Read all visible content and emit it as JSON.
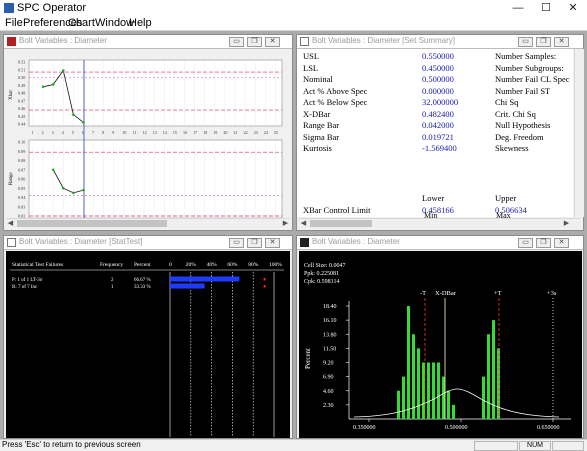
{
  "app": {
    "title": "SPC Operator"
  },
  "window_controls": {
    "minimize": "—",
    "maximize": "☐",
    "close": "✕"
  },
  "menu": [
    "File",
    "Preferences",
    "Chart",
    "Window",
    "Help"
  ],
  "pane_buttons": {
    "minimize": "▭",
    "restore": "❐",
    "close": "✕"
  },
  "panes": {
    "chart": {
      "title": "Bolt Variables : Diameter",
      "xbar_ylabel": "Xbar",
      "range_ylabel": "Range",
      "xbar_ticks": [
        "0.52",
        "0.51",
        "0.50",
        "0.49",
        "0.48",
        "0.47",
        "0.46",
        "0.45",
        "0.44"
      ],
      "range_ticks": [
        "0.10",
        "0.09",
        "0.08",
        "0.07",
        "0.06",
        "0.05",
        "0.04",
        "0.03",
        "0.02"
      ],
      "x_ticks": [
        "1",
        "2",
        "3",
        "4",
        "5",
        "6",
        "7",
        "8",
        "9",
        "10",
        "11",
        "12",
        "13",
        "14",
        "15",
        "16",
        "17",
        "18",
        "19",
        "20",
        "21",
        "22",
        "23",
        "24",
        "25"
      ],
      "xbar_values": [
        0.488,
        0.491,
        0.509,
        0.452,
        0.442
      ],
      "range_values": [
        0.07,
        0.05,
        0.045,
        0.048
      ],
      "xbar_limits": {
        "ucl": 0.507,
        "lcl": 0.458,
        "center": 0.5
      },
      "range_limits": {
        "ucl": 0.089,
        "lcl": 0.0,
        "center": 0.042
      }
    },
    "summary": {
      "title": "Bolt Variables : Diameter  [Set Summary]",
      "rows": [
        {
          "label": "USL",
          "value": "0.550000",
          "label2": "Number Samples:"
        },
        {
          "label": "LSL",
          "value": "0.450000",
          "label2": "Number Subgroups:"
        },
        {
          "label": "Nominal",
          "value": "0.500000",
          "label2": "Number Fail CL Spec"
        },
        {
          "label": "Act % Above Spec",
          "value": "0.000000",
          "label2": "Number Fail ST"
        },
        {
          "label": "Act % Below Spec",
          "value": "32.000000",
          "label2": "Chi Sq"
        },
        {
          "label": "X-DBar",
          "value": "0.482400",
          "label2": "Crit. Chi Sq"
        },
        {
          "label": "Range Bar",
          "value": "0.042000",
          "label2": "Null Hypothesis"
        },
        {
          "label": "Sigma Bar",
          "value": "0.019721",
          "label2": "Deg. Freedom"
        },
        {
          "label": "Kurtosis",
          "value": "-1.569400",
          "label2": "Skewness"
        }
      ],
      "col_lower": "Lower",
      "col_upper": "Upper",
      "limits": [
        {
          "label": "XBar Control Limit",
          "lower": "0.458166",
          "upper": "0.506634"
        },
        {
          "label": "Range Control Limit",
          "lower": "0.000000",
          "upper": "0.088788"
        }
      ],
      "col_min": "Min",
      "col_max": "Max"
    },
    "stattest": {
      "title": "Bolt Variables : Diameter  [StatTest]",
      "headers": {
        "failures": "Statistical Test Failures",
        "frequency": "Frequency",
        "percent": "Percent"
      },
      "scale": [
        "0",
        "20%",
        "40%",
        "60%",
        "80%",
        "100%"
      ],
      "rows": [
        {
          "name": "P: 1 of 1 LT-3σ",
          "frequency": "2",
          "percent": "66.67 %",
          "fraction": 0.6667
        },
        {
          "name": "R: 7 of 7 Inc",
          "frequency": "1",
          "percent": "33.33 %",
          "fraction": 0.3333
        }
      ],
      "bar_color": "#1e3cff",
      "marker_color": "#ff2020"
    },
    "histogram": {
      "title": "Bolt Variables : Diameter",
      "cell_size": "Cell Size:  0.0047",
      "ppk": "Ppk:  0.225081",
      "cpk": "Cpk:  0.598114",
      "ylabel": "Percent",
      "yticks": [
        "18.40",
        "16.10",
        "13.80",
        "11.50",
        "9.20",
        "6.90",
        "4.60",
        "2.30"
      ],
      "xticks": [
        "0.350000",
        "0.500000",
        "0.650000"
      ],
      "markers": {
        "minus_t": "-T",
        "xdbar": "X-DBar",
        "plus_t": "+T",
        "plus_3s": "+3s"
      },
      "bar_color": "#33dd33"
    }
  },
  "status": {
    "hint": "Press 'Esc' to return to previous screen",
    "num": "NUM"
  }
}
